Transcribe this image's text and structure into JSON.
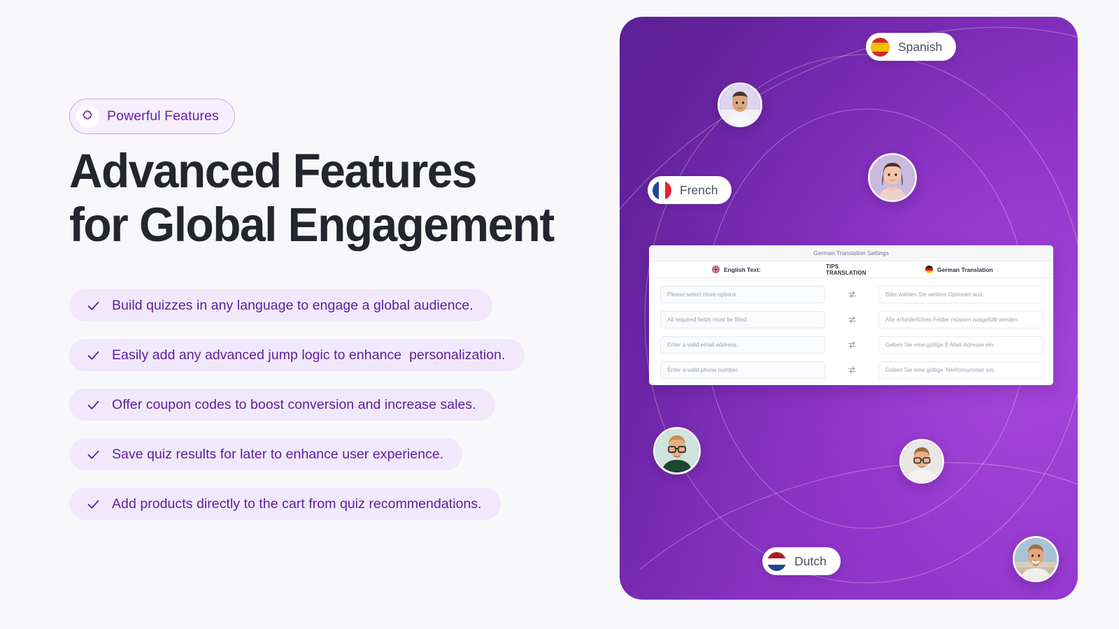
{
  "theme": {
    "page_bg": "#f8f8fb",
    "accent_purple": "#6b21b0",
    "panel_dark": "#5d2096",
    "panel_light": "#9239cb",
    "chip_bg": "#f1e9fb",
    "chip_text": "#5c1e9e",
    "headline_color": "#24262d"
  },
  "eyebrow": {
    "label": "Powerful Features",
    "icon": "puzzle-piece-icon"
  },
  "headline": {
    "line1": "Advanced Features",
    "line2": "for Global Engagement"
  },
  "features": [
    {
      "text": "Build quizzes in any language to engage a global audience.",
      "icon": "check-icon"
    },
    {
      "text": "Easily add any advanced jump logic to enhance  personalization.",
      "icon": "check-icon"
    },
    {
      "text": "Offer coupon codes to boost conversion and increase sales.",
      "icon": "check-icon"
    },
    {
      "text": "Save quiz results for later to enhance user experience.",
      "icon": "check-icon"
    },
    {
      "text": "Add products directly to the cart from quiz recommendations.",
      "icon": "check-icon"
    }
  ],
  "panel": {
    "language_pills": [
      {
        "label": "Spanish",
        "icon": "flag-spain-icon"
      },
      {
        "label": "French",
        "icon": "flag-france-icon"
      },
      {
        "label": "Dutch",
        "icon": "flag-netherlands-icon"
      }
    ],
    "avatars": [
      {
        "name": "avatar-person-1"
      },
      {
        "name": "avatar-person-2"
      },
      {
        "name": "avatar-person-3"
      },
      {
        "name": "avatar-person-4"
      },
      {
        "name": "avatar-person-5"
      }
    ],
    "translation_card": {
      "title": "German Translation Settings",
      "columns": {
        "english": {
          "label": "English Text:",
          "icon": "flag-uk-icon"
        },
        "tips": {
          "label": "TIPS TRANSLATION"
        },
        "german": {
          "label": "German Translation",
          "icon": "flag-germany-icon"
        }
      },
      "swap_icon": "swap-arrows-icon",
      "rows": [
        {
          "english": "Please select more options.",
          "german": "Bitte wählen Sie weitere Optionen aus."
        },
        {
          "english": "All required fields must be filled.",
          "german": "Alle erforderlichen Felder müssen ausgefüllt werden."
        },
        {
          "english": "Enter a valid email address.",
          "german": "Geben Sie eine gültige E-Mail-Adresse ein."
        },
        {
          "english": "Enter a valid phone number.",
          "german": "Geben Sie eine gültige Telefonnummer ein."
        }
      ]
    }
  }
}
